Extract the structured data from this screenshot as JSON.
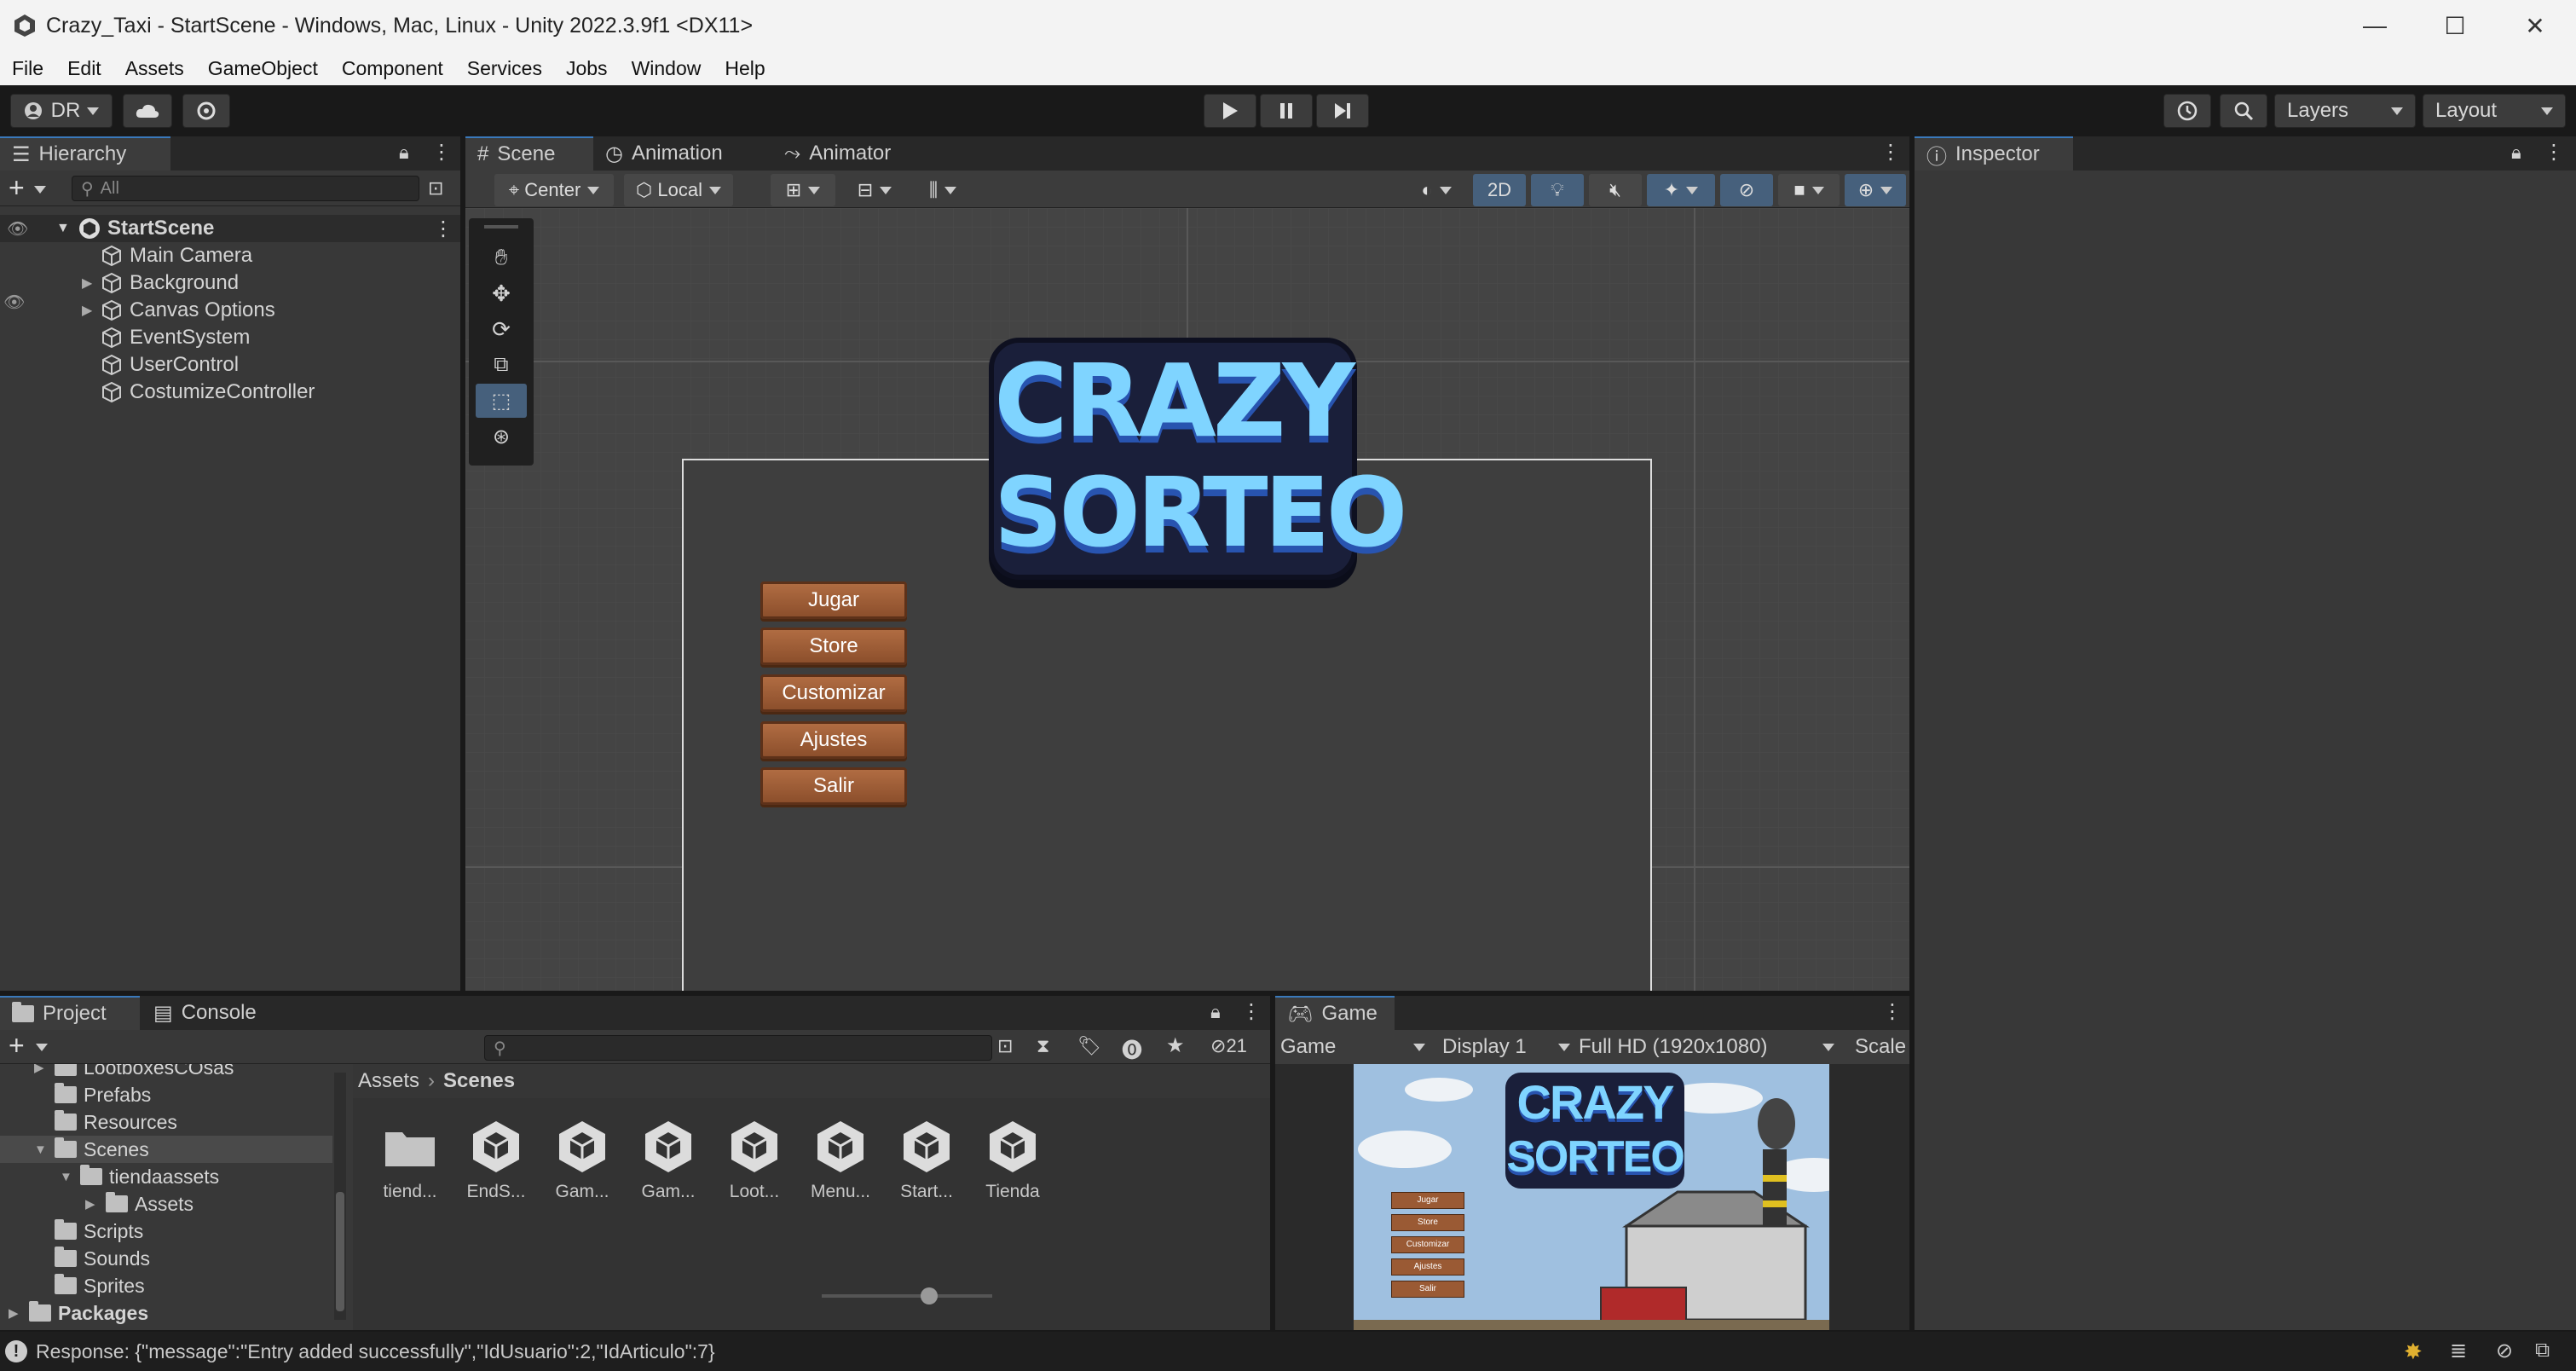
{
  "window": {
    "title": "Crazy_Taxi - StartScene - Windows, Mac, Linux - Unity 2022.3.9f1 <DX11>",
    "minimize": "—",
    "maximize": "☐",
    "close": "✕"
  },
  "menu": [
    "File",
    "Edit",
    "Assets",
    "GameObject",
    "Component",
    "Services",
    "Jobs",
    "Window",
    "Help"
  ],
  "toolbar": {
    "account": "DR",
    "layers_label": "Layers",
    "layout_label": "Layout"
  },
  "hierarchy": {
    "tab": "Hierarchy",
    "search_placeholder": "All",
    "scene": "StartScene",
    "items": [
      {
        "label": "Main Camera",
        "expandable": false
      },
      {
        "label": "Background",
        "expandable": true
      },
      {
        "label": "Canvas Options",
        "expandable": true
      },
      {
        "label": "EventSystem",
        "expandable": false
      },
      {
        "label": "UserControl",
        "expandable": false
      },
      {
        "label": "CostumizeController",
        "expandable": false
      }
    ]
  },
  "scene_view": {
    "tabs": [
      "Scene",
      "Animation",
      "Animator"
    ],
    "pivot": "Center",
    "space": "Local",
    "mode_2d": "2D",
    "logo_line1": "CRAZY",
    "logo_line2": "SORTEO",
    "buttons": [
      "Jugar",
      "Store",
      "Customizar",
      "Ajustes",
      "Salir"
    ]
  },
  "inspector": {
    "tab": "Inspector"
  },
  "project": {
    "tabs": [
      "Project",
      "Console"
    ],
    "hidden_count": "21",
    "tree": [
      {
        "label": "LootboxesCOsas",
        "indent": 1,
        "arrow": "right"
      },
      {
        "label": "Prefabs",
        "indent": 1,
        "arrow": ""
      },
      {
        "label": "Resources",
        "indent": 1,
        "arrow": ""
      },
      {
        "label": "Scenes",
        "indent": 1,
        "arrow": "down",
        "selected": true
      },
      {
        "label": "tiendaassets",
        "indent": 2,
        "arrow": "down"
      },
      {
        "label": "Assets",
        "indent": 3,
        "arrow": "right"
      },
      {
        "label": "Scripts",
        "indent": 1,
        "arrow": ""
      },
      {
        "label": "Sounds",
        "indent": 1,
        "arrow": ""
      },
      {
        "label": "Sprites",
        "indent": 1,
        "arrow": ""
      },
      {
        "label": "Packages",
        "indent": 0,
        "arrow": "right"
      }
    ],
    "breadcrumb": [
      "Assets",
      "Scenes"
    ],
    "assets": [
      {
        "label": "tiend...",
        "kind": "folder"
      },
      {
        "label": "EndS...",
        "kind": "scene"
      },
      {
        "label": "Gam...",
        "kind": "scene"
      },
      {
        "label": "Gam...",
        "kind": "scene"
      },
      {
        "label": "Loot...",
        "kind": "scene"
      },
      {
        "label": "Menu...",
        "kind": "scene"
      },
      {
        "label": "Start...",
        "kind": "scene"
      },
      {
        "label": "Tienda",
        "kind": "scene"
      }
    ]
  },
  "game_view": {
    "tab": "Game",
    "mode": "Game",
    "display": "Display 1",
    "resolution": "Full HD (1920x1080)",
    "scale": "Scale",
    "logo_line1": "CRAZY",
    "logo_line2": "SORTEO",
    "buttons": [
      "Jugar",
      "Store",
      "Customizar",
      "Ajustes",
      "Salir"
    ]
  },
  "status": {
    "message": "Response: {\"message\":\"Entry added successfully\",\"IdUsuario\":2,\"IdArticulo\":7}"
  },
  "colors": {
    "accent": "#3a79bb",
    "panel": "#383838",
    "button_wood": "#a0603a"
  }
}
